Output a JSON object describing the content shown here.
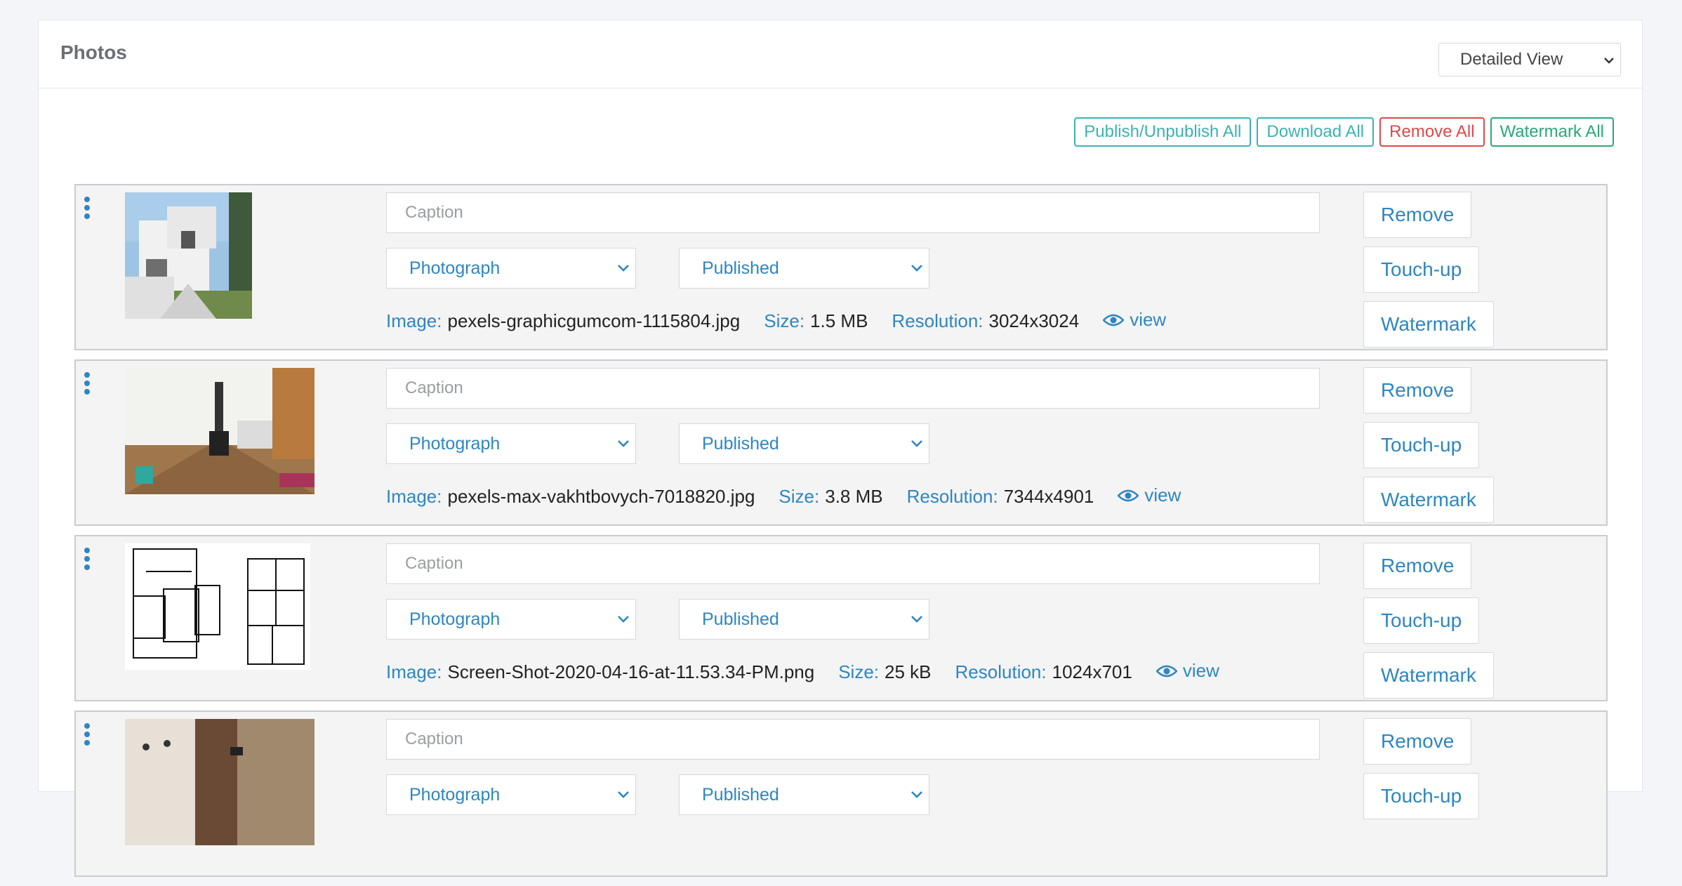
{
  "panel": {
    "title": "Photos",
    "view_select": "Detailed View"
  },
  "bulk_actions": {
    "publish": {
      "label": "Publish/Unpublish All",
      "color": "#3bb3b3"
    },
    "download": {
      "label": "Download All",
      "color": "#3bb3b3"
    },
    "remove": {
      "label": "Remove All",
      "color": "#e04848"
    },
    "watermark": {
      "label": "Watermark All",
      "color": "#2aa876"
    }
  },
  "labels": {
    "caption_placeholder": "Caption",
    "image": "Image:",
    "size": "Size:",
    "resolution": "Resolution:",
    "view": "view",
    "remove": "Remove",
    "touchup": "Touch-up",
    "watermark": "Watermark"
  },
  "photos": [
    {
      "type": "Photograph",
      "status": "Published",
      "image": "pexels-graphicgumcom-1115804.jpg",
      "size": "1.5 MB",
      "resolution": "3024x3024"
    },
    {
      "type": "Photograph",
      "status": "Published",
      "image": "pexels-max-vakhtbovych-7018820.jpg",
      "size": "3.8 MB",
      "resolution": "7344x4901"
    },
    {
      "type": "Photograph",
      "status": "Published",
      "image": "Screen-Shot-2020-04-16-at-11.53.34-PM.png",
      "size": "25 kB",
      "resolution": "1024x701"
    },
    {
      "type": "Photograph",
      "status": "Published",
      "image": "",
      "size": "",
      "resolution": ""
    }
  ],
  "colors": {
    "accent": "#2e86c1",
    "row_bg": "#f4f4f4",
    "row_border": "#c9ccd0"
  }
}
